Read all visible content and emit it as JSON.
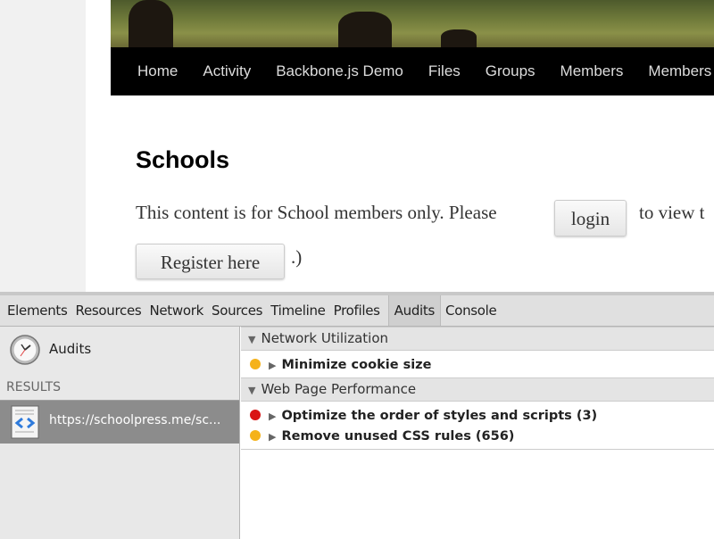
{
  "nav": {
    "items": [
      "Home",
      "Activity",
      "Backbone.js Demo",
      "Files",
      "Groups",
      "Members",
      "Members"
    ]
  },
  "content": {
    "title": "Schools",
    "text_before": "This content is for School members only. Please",
    "login_label": "login",
    "text_after": "to view t",
    "register_label": "Register here",
    "suffix": ".)"
  },
  "devtools": {
    "tabs": [
      "Elements",
      "Resources",
      "Network",
      "Sources",
      "Timeline",
      "Profiles",
      "Audits",
      "Console"
    ],
    "active_tab": "Audits",
    "sidebar": {
      "audits_label": "Audits",
      "results_label": "RESULTS",
      "result_url": "https://schoolpress.me/sc..."
    },
    "sections": [
      {
        "title": "Network Utilization",
        "items": [
          {
            "label": "Minimize cookie size",
            "severity": "warning"
          }
        ]
      },
      {
        "title": "Web Page Performance",
        "items": [
          {
            "label": "Optimize the order of styles and scripts (3)",
            "severity": "severe"
          },
          {
            "label": "Remove unused CSS rules (656)",
            "severity": "warning"
          }
        ]
      }
    ],
    "colors": {
      "warning": "#f5b21a",
      "severe": "#d91414"
    }
  }
}
